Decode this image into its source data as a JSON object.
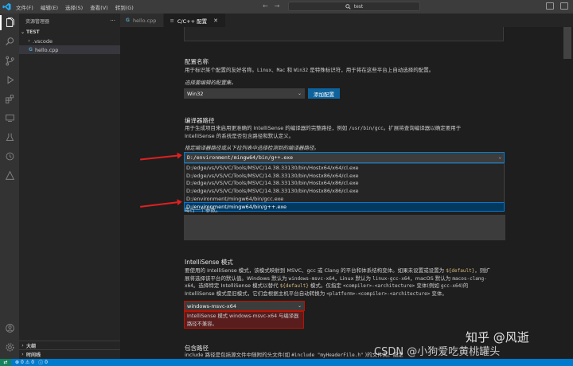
{
  "titlebar": {
    "menu": [
      "文件(F)",
      "编辑(E)",
      "选择(S)",
      "查看(V)",
      "转到(G)"
    ],
    "search_text": "test"
  },
  "sidebar": {
    "header": "资源管理器",
    "folder": "TEST",
    "items": [
      ".vscode",
      "hello.cpp"
    ],
    "bottom_sections": [
      "大纲",
      "时间线"
    ]
  },
  "tabs": [
    {
      "label": "hello.cpp",
      "active": false
    },
    {
      "label": "C/C++ 配置",
      "active": true
    }
  ],
  "config_name": {
    "title": "配置名称",
    "description_pre": "用于标识某个配置的友好名称。",
    "code_items": [
      "Linux",
      "Mac",
      "Win32"
    ],
    "and_text": "和",
    "description_post": "是特殊标识符，用于将在这些平台上自动选择的配置。",
    "prompt": "选择要编辑的配置集。",
    "selected": "Win32",
    "add_button": "添加配置"
  },
  "compiler_path": {
    "title": "编译器路径",
    "description_line1_pre": "用于生成项目来启用更准确的 IntelliSense 的编译器的完整路径，例如",
    "description_line1_code": "/usr/bin/gcc",
    "description_line1_post": "。扩展将查询编译器以确定要用于",
    "description_line2": "IntelliSense 的系统是否包含路径和默认定义。",
    "prompt": "指定编译器路径或从下拉列表中选择检测到的编译器路径。",
    "value": "D:/environment/mingw64/bin/g++.exe",
    "options": [
      "D:/edge/vs/VS/VC/Tools/MSVC/14.38.33130/bin/Hostx64/x64/cl.exe",
      "D:/edge/vs/VS/VC/Tools/MSVC/14.38.33130/bin/Hostx86/x64/cl.exe",
      "D:/edge/vs/VS/VC/Tools/MSVC/14.38.33130/bin/Hostx64/x86/cl.exe",
      "D:/edge/vs/VS/VC/Tools/MSVC/14.38.33130/bin/Hostx86/x86/cl.exe",
      "D:/environment/mingw64/bin/gcc.exe",
      "D:/environment/mingw64/bin/g++.exe"
    ],
    "selected_index": 5,
    "args_hint": "每行一个参数。"
  },
  "intellisense_mode": {
    "title": "IntelliSense 模式",
    "line1_pre": "要使用的 IntelliSense 模式，该模式映射到 MSVC、gcc 或 Clang 的平台和体系结构变体。如果未设置或设置为",
    "line1_code": "${default}",
    "line1_post": "，则扩",
    "line2_pre": "展将选择该平台的默认值。Windows 默认为",
    "line2_code1": "windows-msvc-x64",
    "line2_mid": "，Linux 默认为",
    "line2_code2": "linux-gcc-x64",
    "line2_mid2": "，macOS 默认为",
    "line2_code3": "macos-clang-",
    "line3_code": "x64",
    "line3_mid": "。选择特定 IntelliSense 模式以替代",
    "line3_code2": "${default}",
    "line3_mid2": "模式。仅指定",
    "line3_code3": "<compiler>-<architecture>",
    "line3_post": "变体(例如",
    "line3_code4": "gcc-x64",
    "line3_end": ")的",
    "line4_pre": "IntelliSense 模式是旧模式，它们会根据主机平台自动转换为",
    "line4_code": "<platform>-<compiler>-<architecture>",
    "line4_post": "变体。",
    "selected": "windows-msvc-x64",
    "error": "IntelliSense 模式 windows-msvc-x64 与编译器路径不兼容。"
  },
  "include_path": {
    "title": "包含路径",
    "line_pre": "include 路径是包括源文件中随附的头文件(如",
    "line_code": "#include \"myHeaderFile.h\"",
    "line_post": ")的文件夹。指定"
  },
  "statusbar": {
    "errors": "0",
    "warnings": "0",
    "info": "0"
  },
  "watermark": {
    "zhihu": "知乎 @风逝",
    "csdn": "CSDN @小狗爱吃黄桃罐头"
  },
  "colors": {
    "accent": "#007acc",
    "button": "#0e639c",
    "error_bg": "#5a1d1d",
    "arrow": "#e02020"
  }
}
